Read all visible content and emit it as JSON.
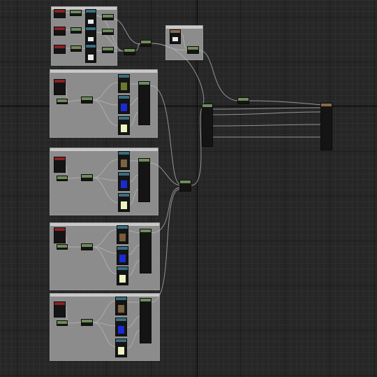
{
  "editor": {
    "view": "material-node-graph"
  },
  "colors": {
    "background": "#262626",
    "comment_fill": "#8c8c8c",
    "texture_header": "#8a2222",
    "param_header": "#6e8c5a",
    "sampler_header": "#3a6e82",
    "output_header": "#8a6a4a",
    "wire": "#b8b8b8",
    "swatch_olive": "#6a7a2a",
    "swatch_blue": "#1a2bd6",
    "swatch_cream": "#eef2c0",
    "swatch_brown": "#7a5a3e",
    "swatch_sand": "#7a6244",
    "swatch_white": "#e8e8e8",
    "swatch_grey": "#bdbdbd"
  },
  "icons": [
    "wire-connection",
    "pin-dot"
  ]
}
